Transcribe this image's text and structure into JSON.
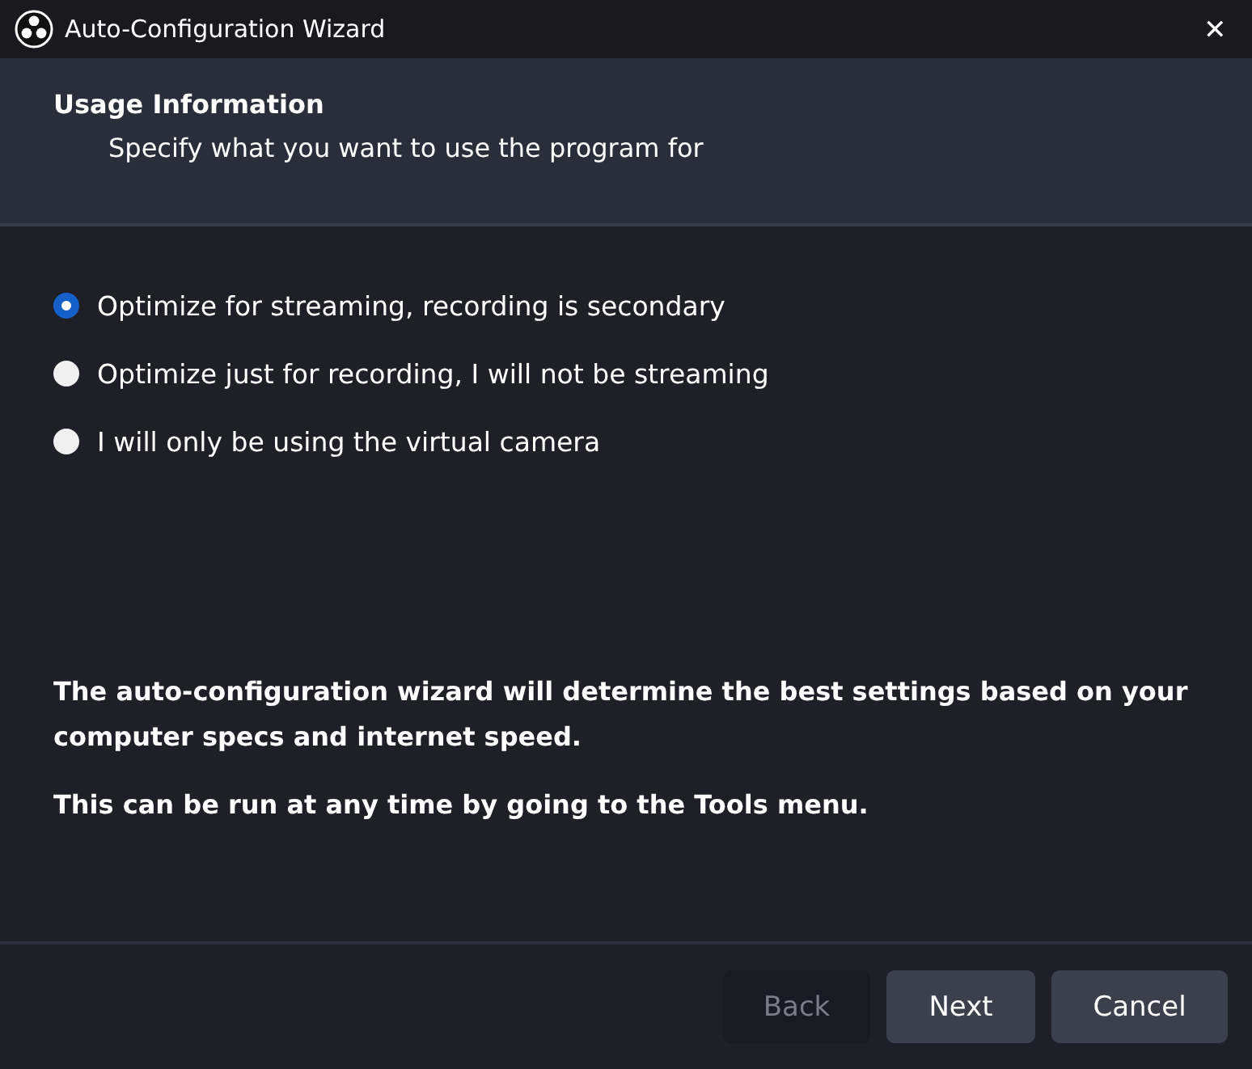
{
  "window": {
    "title": "Auto-Configuration Wizard",
    "close": "✕"
  },
  "header": {
    "title": "Usage Information",
    "subtitle": "Specify what you want to use the program for"
  },
  "options": [
    {
      "label": "Optimize for streaming, recording is secondary",
      "selected": true
    },
    {
      "label": "Optimize just for recording, I will not be streaming",
      "selected": false
    },
    {
      "label": "I will only be using the virtual camera",
      "selected": false
    }
  ],
  "notes": [
    "The auto-configuration wizard will determine the best settings based on your computer specs and internet speed.",
    "This can be run at any time by going to the Tools menu."
  ],
  "buttons": [
    {
      "label": "Back",
      "disabled": true
    },
    {
      "label": "Next",
      "disabled": false
    },
    {
      "label": "Cancel",
      "disabled": false
    }
  ]
}
